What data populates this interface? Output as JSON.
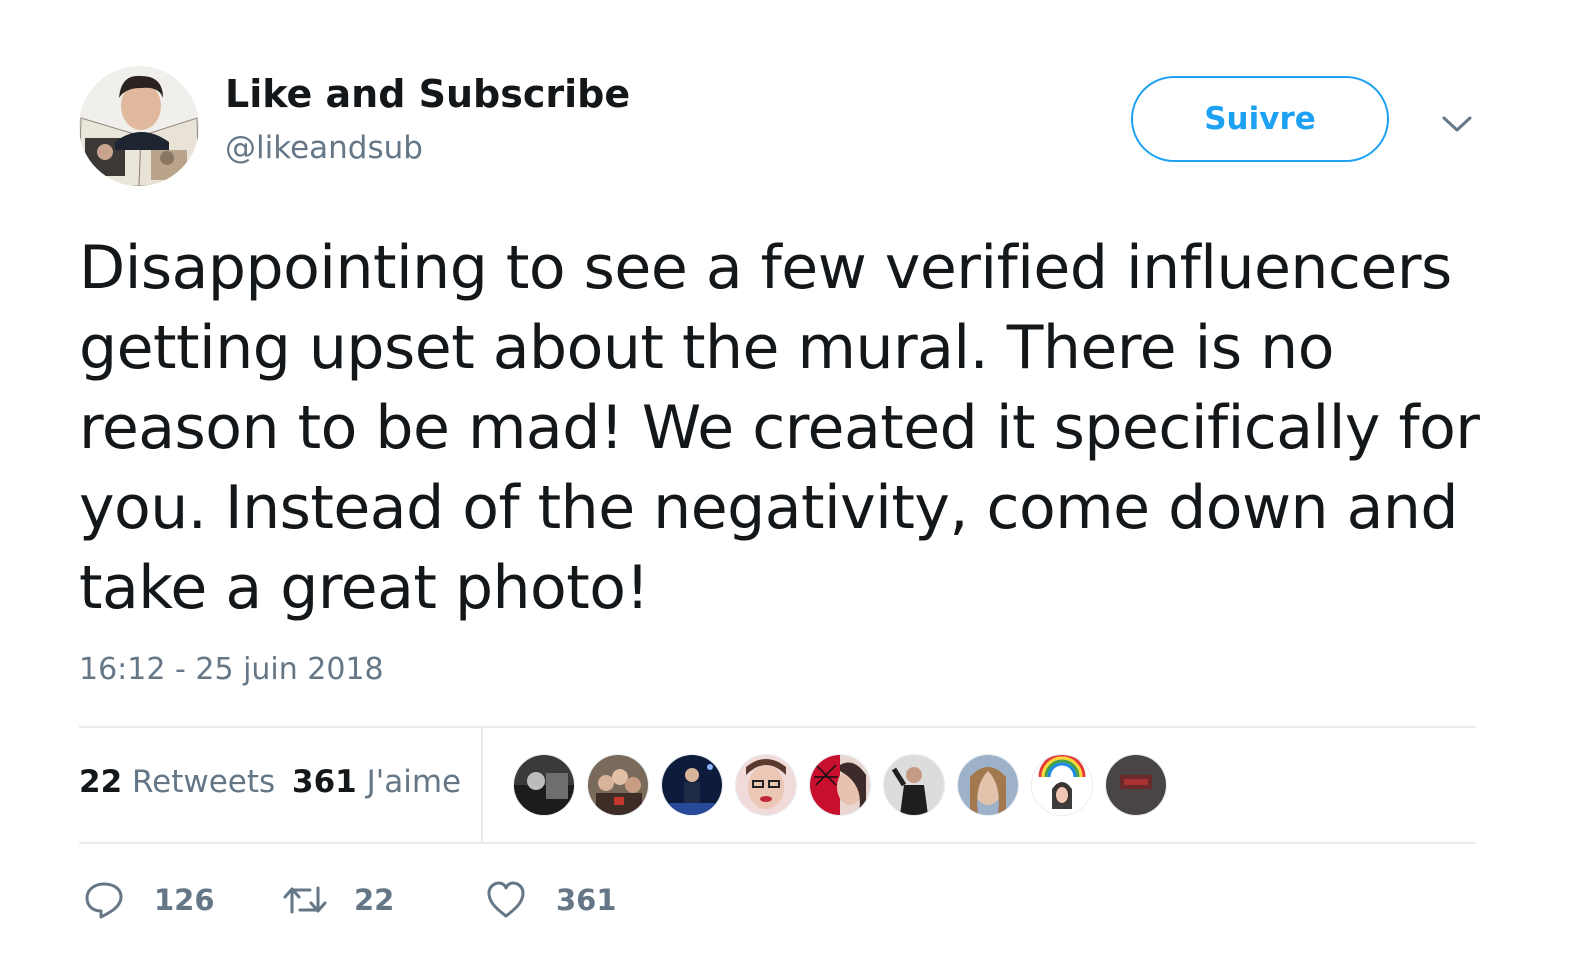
{
  "author": {
    "display_name": "Like and Subscribe",
    "handle": "@likeandsub",
    "avatar_icon": "profile-photo-avatar"
  },
  "follow_button": {
    "label": "Suivre",
    "color": "#1da1f2"
  },
  "menu_icon": "chevron-down-icon",
  "tweet": {
    "text": "Disappointing to see a few verified influencers getting upset about the mural. There is no reason to be mad! We created it specifically for you. Instead of the negativity, come down and take a great photo!",
    "timestamp": "16:12 - 25 juin 2018"
  },
  "stats": {
    "retweets_count": "22",
    "retweets_label": "Retweets",
    "likes_count": "361",
    "likes_label": "J'aime"
  },
  "likers": [
    {
      "icon": "liker-avatar-1"
    },
    {
      "icon": "liker-avatar-2"
    },
    {
      "icon": "liker-avatar-3"
    },
    {
      "icon": "liker-avatar-4"
    },
    {
      "icon": "liker-avatar-5"
    },
    {
      "icon": "liker-avatar-6"
    },
    {
      "icon": "liker-avatar-7"
    },
    {
      "icon": "liker-avatar-8"
    },
    {
      "icon": "liker-avatar-9"
    }
  ],
  "actions": {
    "reply_count": "126",
    "retweet_count": "22",
    "like_count": "361"
  },
  "colors": {
    "text": "#14171a",
    "secondary": "#657786",
    "accent": "#1da1f2",
    "divider": "#e6ecf0"
  }
}
